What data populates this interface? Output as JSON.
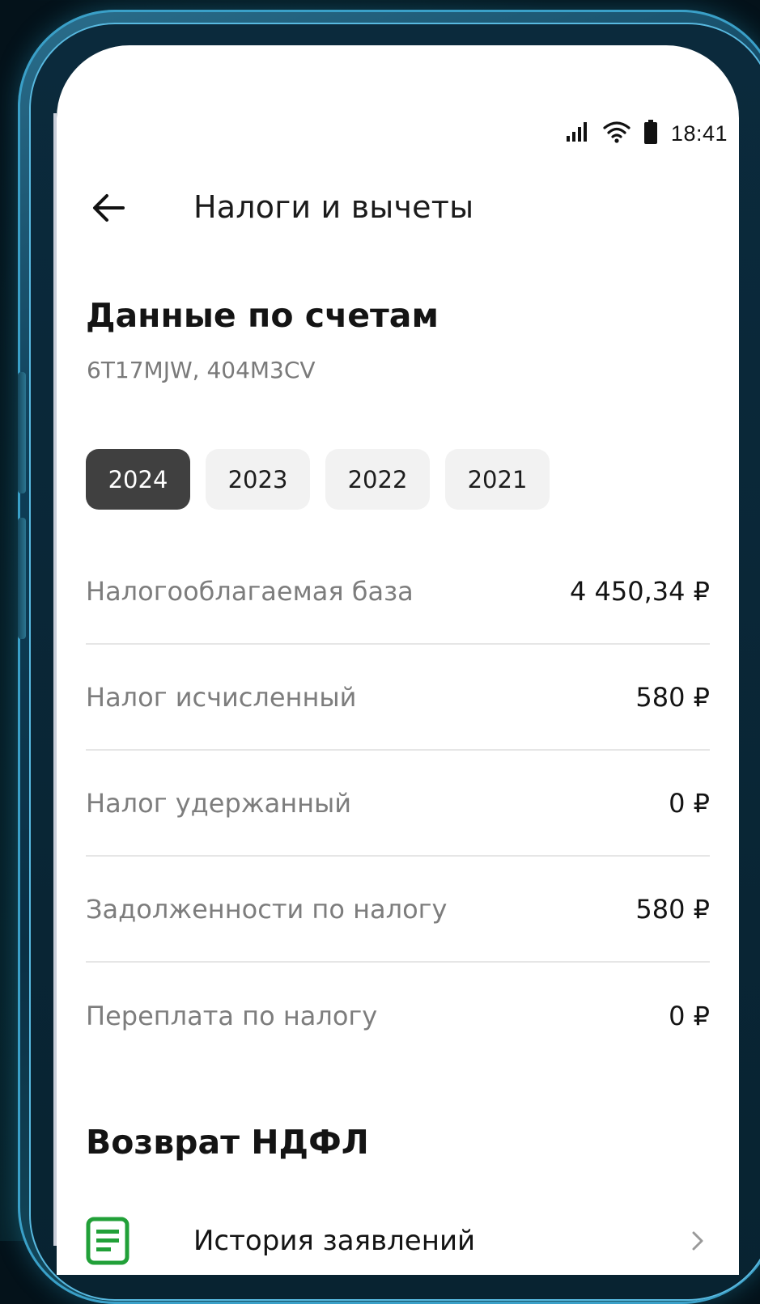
{
  "status_bar": {
    "time": "18:41",
    "icons": [
      "signal-icon",
      "wifi-icon",
      "battery-icon"
    ]
  },
  "header": {
    "title": "Налоги и вычеты",
    "back_icon": "arrow-left-icon"
  },
  "accounts": {
    "title": "Данные по счетам",
    "subtitle": "6T17MJW, 404M3CV"
  },
  "years": [
    {
      "label": "2024",
      "selected": true
    },
    {
      "label": "2023",
      "selected": false
    },
    {
      "label": "2022",
      "selected": false
    },
    {
      "label": "2021",
      "selected": false
    }
  ],
  "rows": [
    {
      "label": "Налогооблагаемая база",
      "value": "4 450,34 ₽"
    },
    {
      "label": "Налог исчисленный",
      "value": "580 ₽"
    },
    {
      "label": "Налог удержанный",
      "value": "0 ₽"
    },
    {
      "label": "Задолженности по налогу",
      "value": "580 ₽"
    },
    {
      "label": "Переплата по налогу",
      "value": "0 ₽"
    }
  ],
  "refund": {
    "title": "Возврат НДФЛ",
    "history_label": "История заявлений",
    "history_icon": "document-icon",
    "chevron_icon": "chevron-right-icon"
  },
  "colors": {
    "chip_active": "#404040",
    "chip_inactive": "#f2f2f2",
    "doc_icon": "#21a038",
    "label_gray": "#7d7d7d"
  }
}
